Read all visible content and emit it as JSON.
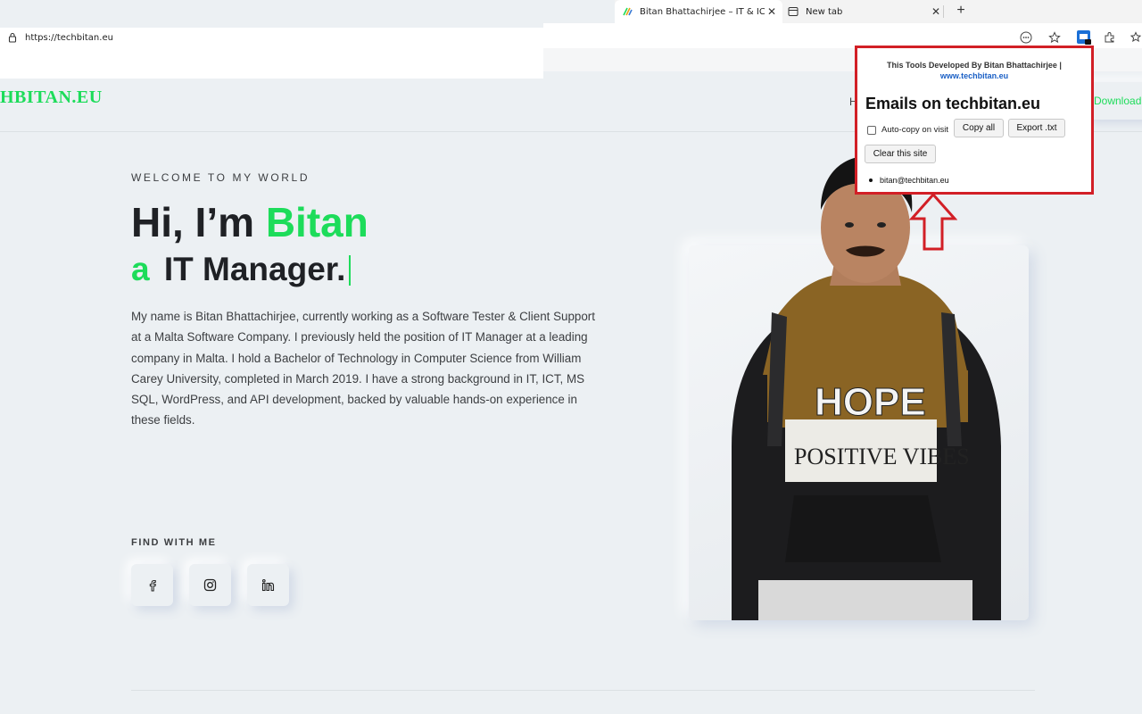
{
  "browser": {
    "tabs": [
      {
        "title": "Bitan Bhattachirjee – IT & ICT Fiel",
        "active": true
      },
      {
        "title": "New tab",
        "active": false
      }
    ],
    "new_tab_label": "+",
    "url": "https://techbitan.eu"
  },
  "site": {
    "logo": "HBITAN.EU",
    "nav_partial": "H",
    "download_label": "Download",
    "welcome": "WELCOME TO MY WORLD",
    "heading_prefix": "Hi, I’m ",
    "heading_name": "Bitan",
    "subheading_prefix": "a",
    "subheading_role": "IT Manager.",
    "bio": "My name is Bitan Bhattachirjee, currently working as a Software Tester & Client Support at a Malta Software Company. I previously held the position of IT Manager at a leading company in Malta. I hold a Bachelor of Technology in Computer Science from William Carey University, completed in March 2019. I have a strong background in IT, ICT, MS SQL, WordPress, and API development, backed by valuable hands-on experience in these fields.",
    "find_with_me": "FIND WITH ME",
    "social_icons": [
      "facebook-icon",
      "instagram-icon",
      "linkedin-icon"
    ],
    "photo_shirt_line1": "HOPE",
    "photo_shirt_line2": "POSITIVE VIBES"
  },
  "popup": {
    "developer_line": "This Tools Developed By Bitan Bhattachirjee |",
    "developer_link": "www.techbitan.eu",
    "title": "Emails on techbitan.eu",
    "auto_copy_label": "Auto-copy on visit",
    "auto_copy_checked": false,
    "copy_all_label": "Copy all",
    "export_label": "Export .txt",
    "clear_label": "Clear this site",
    "emails": [
      "bitan@techbitan.eu"
    ]
  },
  "colors": {
    "accent_green": "#1ddc5a",
    "page_bg": "#ecf0f3",
    "highlight_red": "#d21f26",
    "heading_dark": "#1f2125"
  }
}
